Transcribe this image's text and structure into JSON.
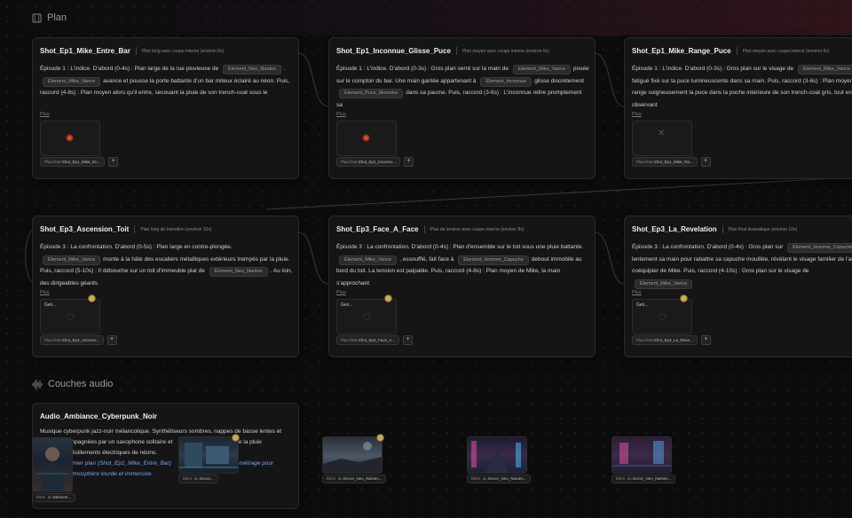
{
  "sections": {
    "plan": "Plan",
    "audio": "Couches audio"
  },
  "shots": [
    {
      "title": "Shot_Ep1_Mike_Entre_Bar",
      "subtitle": "Plan long avec coupe interne (environ 8s)",
      "body": [
        {
          "t": "text",
          "v": "Épisode 1 : L'indice. D'abord (0-4s) : Plan large de la rue pluvieuse de"
        },
        {
          "t": "chip",
          "v": "Element_Neo_Nantes"
        },
        {
          "t": "text",
          "v": "."
        },
        {
          "t": "chip",
          "v": "Element_Mike_Vance"
        },
        {
          "t": "text",
          "v": "avance et pousse la porte battante d'un bar miteux éclairé au néon. Puis, raccord (4-8s) : Plan moyen alors qu'il entre, secouant la pluie de son trench-coat sous le"
        }
      ],
      "plus": "Plus",
      "thumb": {
        "type": "glow",
        "label": ""
      },
      "ref": {
        "prefix": "Plan final",
        "name": "Shot_Ep1_Mike_En..."
      }
    },
    {
      "title": "Shot_Ep1_Inconnue_Glisse_Puce",
      "subtitle": "Plan moyen avec coupe interne (environ 6s)",
      "body": [
        {
          "t": "text",
          "v": "Épisode 1 : L'indice. D'abord (0-3s) : Gros plan serré sur la main de"
        },
        {
          "t": "chip",
          "v": "Element_Mike_Vance"
        },
        {
          "t": "text",
          "v": "posée sur le comptoir du bar. Une main gantée appartenant à"
        },
        {
          "t": "chip",
          "v": "Element_Inconnue"
        },
        {
          "t": "text",
          "v": "glisse discrètement"
        },
        {
          "t": "chip",
          "v": "Element_Puce_Memoire"
        },
        {
          "t": "text",
          "v": "dans sa paume. Puis, raccord (3-6s) : L'inconnue retire promptement sa"
        }
      ],
      "plus": "Plus",
      "thumb": {
        "type": "glow",
        "label": ""
      },
      "ref": {
        "prefix": "Plan final",
        "name": "Shot_Ep1_Inconnu..."
      }
    },
    {
      "title": "Shot_Ep1_Mike_Range_Puce",
      "subtitle": "Plan moyen avec coupe interne (environ 6s)",
      "body": [
        {
          "t": "text",
          "v": "Épisode 1 : L'indice. D'abord (0-3s) : Gros plan sur le visage de"
        },
        {
          "t": "chip",
          "v": "Element_Mike_Vance"
        },
        {
          "t": "text",
          "v": ", fatigué fixé sur la puce lumineuscente dans sa main. Puis, raccord (3-6s) : Plan moyen, il range soigneusement la puce dans la poche intérieure de son trench-coat gris, tout en observant"
        }
      ],
      "plus": "Plus",
      "thumb": {
        "type": "x",
        "label": ""
      },
      "ref": {
        "prefix": "Plan final",
        "name": "Shot_Ep1_Mike_Ra..."
      }
    },
    {
      "title": "Shot_Ep3_Ascension_Toit",
      "subtitle": "Plan long de transition (environ 10s)",
      "body": [
        {
          "t": "text",
          "v": "Épisode 3 : La confrontation. D'abord (0-5s) : Plan large en contre-plongée."
        },
        {
          "t": "chip",
          "v": "Element_Mike_Vance"
        },
        {
          "t": "text",
          "v": "monte à la hâte des escaliers métalliques extérieurs trempés par la pluie. Puis, raccord (5-10s) : Il débouche sur un toit d'immeuble plat de"
        },
        {
          "t": "chip",
          "v": "Element_Neo_Nantes"
        },
        {
          "t": "text",
          "v": ". Au loin, des dirigeables géants"
        }
      ],
      "plus": "Plus",
      "thumb": {
        "type": "gen",
        "label": "Gen..."
      },
      "ref": {
        "prefix": "Plan final",
        "name": "Shot_Ep3_Ascensi..."
      }
    },
    {
      "title": "Shot_Ep3_Face_A_Face",
      "subtitle": "Plan de tension avec coupe interne (environ 8s)",
      "body": [
        {
          "t": "text",
          "v": "Épisode 3 : La confrontation. D'abord (0-4s) : Plan d'ensemble sur le toit sous une pluie battante."
        },
        {
          "t": "chip",
          "v": "Element_Mike_Vance"
        },
        {
          "t": "text",
          "v": ", essoufflé, fait face à"
        },
        {
          "t": "chip",
          "v": "Element_Homme_Capuche"
        },
        {
          "t": "text",
          "v": "debout immobile au bord du toit. La tension est palpable. Puis, raccord (4-8s) : Plan moyen de Mike, la main s'approchant"
        }
      ],
      "plus": "Plus",
      "thumb": {
        "type": "gen",
        "label": "Gen..."
      },
      "ref": {
        "prefix": "Plan final",
        "name": "Shot_Ep3_Face_A..."
      }
    },
    {
      "title": "Shot_Ep3_La_Revelation",
      "subtitle": "Plan final dramatique (environ 10s)",
      "body": [
        {
          "t": "text",
          "v": "Épisode 3 : La confrontation. D'abord (0-4s) : Gros plan sur"
        },
        {
          "t": "chip",
          "v": "Element_Homme_Capuche"
        },
        {
          "t": "text",
          "v": "lentement sa main pour rabattre sa capuche mouillée, révélant le visage familier de l'ancien coéquipier de Mike. Puis, raccord (4-10s) : Gros plan sur le visage de"
        },
        {
          "t": "chip",
          "v": "Element_Mike_Vance"
        }
      ],
      "plus": "Plus",
      "thumb": {
        "type": "gen",
        "label": "Gen..."
      },
      "ref": {
        "prefix": "Plan final",
        "name": "Shot_Ep3_La_Reve..."
      }
    }
  ],
  "audio": {
    "title": "Audio_Ambiance_Cyberpunk_Noir",
    "line1": "Musique cyberpunk jazz-noir mélancolique. Synthétiseurs sombres, nappes de basse lentes et",
    "line2": "accompagnées par un saxophone solitaire et",
    "line2b": "ent de la pluie",
    "line3": "les grésillements électriques de néons.",
    "line4": "le premier plan (Shot_Ep1_Mike_Entre_Bar)",
    "line4b": "court-métrage pour",
    "line5": "une atmosphère lourde et immersive."
  },
  "images": [
    {
      "prefix": "Élém. du",
      "name": "Element..."
    },
    {
      "prefix": "Élém. du",
      "name": "Decor..."
    },
    {
      "prefix": "Élém. du",
      "name": "Decor_Neo_Nantes..."
    },
    {
      "prefix": "Élém. du",
      "name": "Decor_Neo_Nantes..."
    },
    {
      "prefix": "Élém. du",
      "name": "Decor_Neo_Nantes..."
    }
  ],
  "colors": {
    "accent": "#7aa3ff",
    "badge": "#c9a85c",
    "card": "#151515",
    "background": "#0c0c0d"
  }
}
